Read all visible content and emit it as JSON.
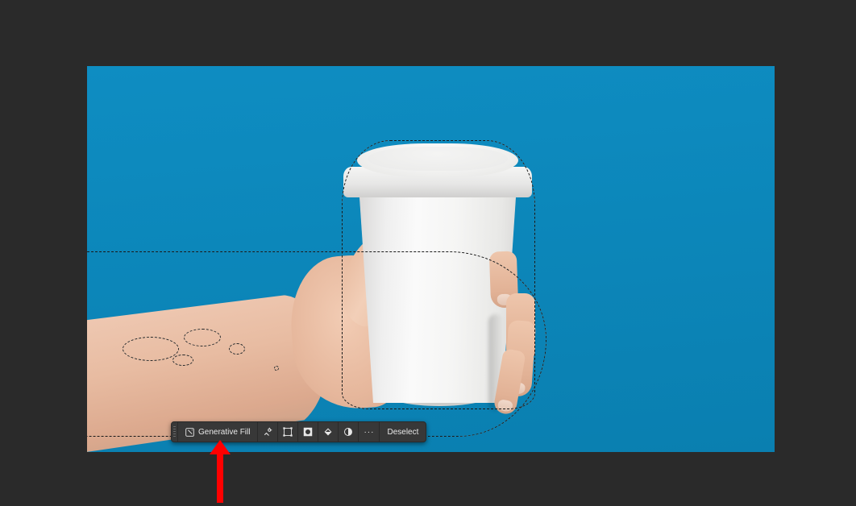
{
  "canvas": {
    "background_color": "#0d8abf",
    "subject": "hand holding white paper cup",
    "selection_active": true,
    "selection_target": "background (blue area)"
  },
  "contextual_taskbar": {
    "generative_fill_label": "Generative Fill",
    "icons": [
      "selection-brush-icon",
      "transform-selection-icon",
      "mask-icon",
      "fill-icon",
      "adjustment-icon"
    ],
    "more_label": "···",
    "deselect_label": "Deselect"
  },
  "annotation": {
    "arrow_points_to": "Generative Fill button",
    "arrow_color": "#ff0000"
  }
}
